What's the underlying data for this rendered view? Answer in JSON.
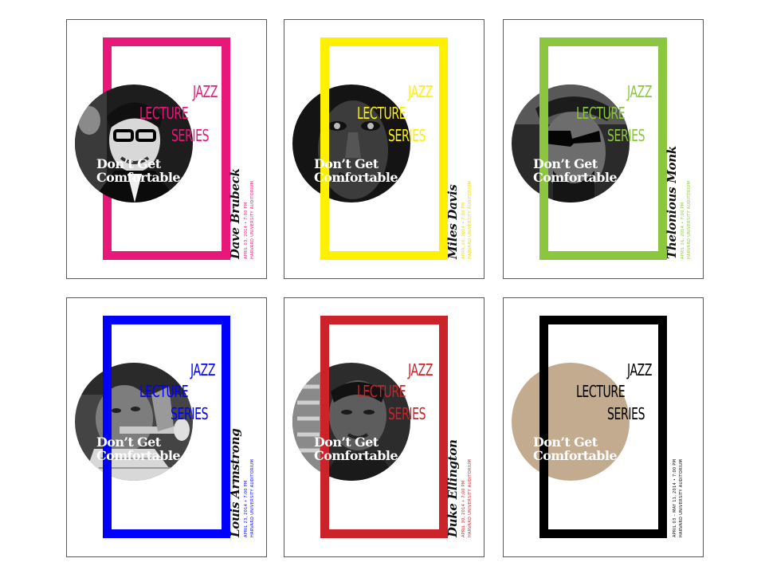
{
  "posters": [
    {
      "accent": "#e8177a",
      "heading": [
        "JAZZ",
        "LECTURE",
        "SERIES"
      ],
      "tagline": [
        "Don’t Get",
        "Comfortable"
      ],
      "name": "Dave Brubeck",
      "info": [
        "APRIL 03, 2014 • 7:00 PM",
        "HARVARD UNIVERSITY AUDITORIUM"
      ]
    },
    {
      "accent": "#fff000",
      "heading": [
        "JAZZ",
        "LECTURE",
        "SERIES"
      ],
      "tagline": [
        "Don’t Get",
        "Comfortable"
      ],
      "name": "Miles Davis",
      "info": [
        "APRIL 10, 2014 • 7:00 PM",
        "HARVARD UNIVERSITY AUDITORIUM"
      ]
    },
    {
      "accent": "#8cc63f",
      "heading": [
        "JAZZ",
        "LECTURE",
        "SERIES"
      ],
      "tagline": [
        "Don’t Get",
        "Comfortable"
      ],
      "name": "Thelonious Monk",
      "info": [
        "APRIL 16, 2014 • 7:00 PM",
        "HARVARD UNIVERSITY AUDITORIUM"
      ]
    },
    {
      "accent": "#0000ff",
      "heading": [
        "JAZZ",
        "LECTURE",
        "SERIES"
      ],
      "tagline": [
        "Don’t Get",
        "Comfortable"
      ],
      "name": "Louis Armstrong",
      "info": [
        "APRIL 23, 2014 • 7:00 PM",
        "HARVARD UNIVERSITY AUDITORIUM"
      ]
    },
    {
      "accent": "#cc2229",
      "heading": [
        "JAZZ",
        "LECTURE",
        "SERIES"
      ],
      "tagline": [
        "Don’t Get",
        "Comfortable"
      ],
      "name": "Duke Ellington",
      "info": [
        "APRIL 30, 2014 • 7:00 PM",
        "HARVARD UNIVERSITY AUDITORIUM"
      ]
    },
    {
      "accent": "#000000",
      "heading": [
        "JAZZ",
        "LECTURE",
        "SERIES"
      ],
      "tagline": [
        "Don’t Get",
        "Comfortable"
      ],
      "name": "",
      "info": [
        "APRIL 03 – MAY 11, 2014 • 7:00 PM",
        "HARVARD UNIVERSITY AUDITORIUM"
      ],
      "circle_color": "#c2ab8f"
    }
  ]
}
